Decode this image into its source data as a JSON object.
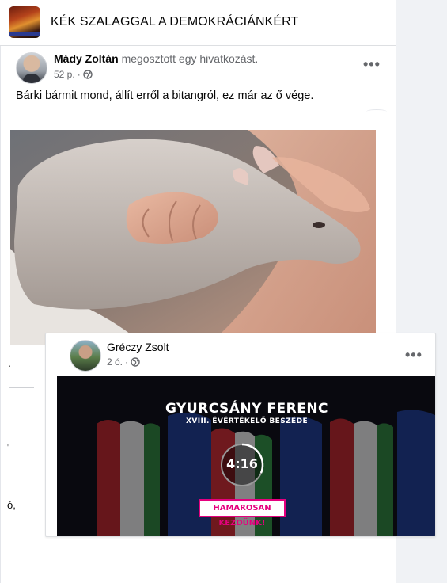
{
  "group": {
    "title": "KÉK SZALAGGAL A DEMOKRÁCIÁNKÉRT"
  },
  "post": {
    "author": "Mády Zoltán",
    "action": "megosztott egy hivatkozást.",
    "time": "52 p.",
    "separator": "·",
    "text": "Bárki bármit mond, állít erről a bitangról, ez már az ő vége.",
    "more": "•••",
    "trailing_text": "."
  },
  "background_fragments": {
    "frag_1": "'",
    "frag_2": "ó,"
  },
  "shared_post": {
    "author": "Gréczy Zsolt",
    "time": "2 ó.",
    "separator": "·",
    "more": "•••",
    "video": {
      "title": "GYURCSÁNY FERENC",
      "subtitle": "XVIII. ÉVÉRTÉKELŐ BESZÉDE",
      "countdown": "4:16",
      "badge": "HAMAROSAN KEZDÜNK!",
      "accent_color": "#e5007e"
    }
  },
  "icons": {
    "privacy": "globe-icon",
    "options": "more-options-icon"
  }
}
